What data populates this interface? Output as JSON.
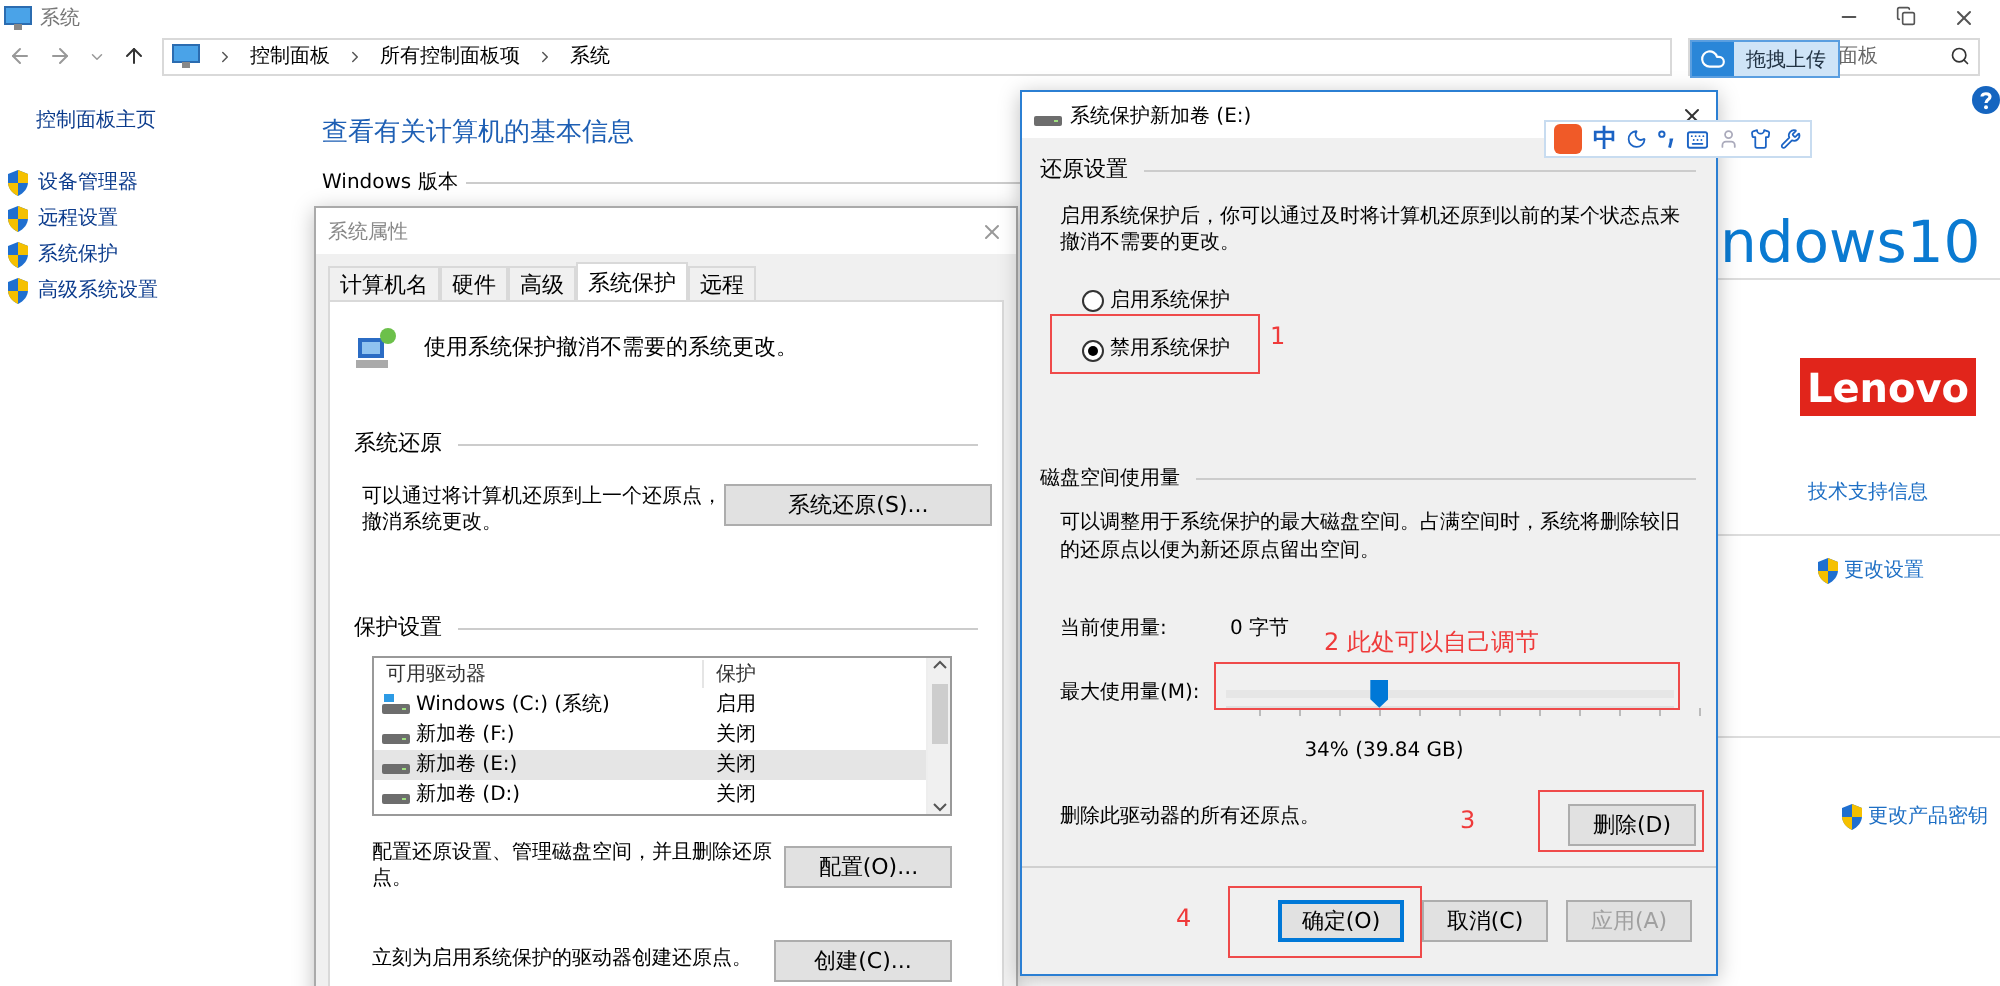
{
  "window": {
    "title": "系统"
  },
  "nav": {
    "breadcrumbs": [
      "控制面板",
      "所有控制面板项",
      "系统"
    ],
    "search_placeholder": "面板"
  },
  "upload_popup": {
    "label": "拖拽上传"
  },
  "sidebar": {
    "home": "控制面板主页",
    "items": [
      "设备管理器",
      "远程设置",
      "系统保护",
      "高级系统设置"
    ]
  },
  "main": {
    "heading": "查看有关计算机的基本信息",
    "section": "Windows 版本",
    "logo_text": "ndows10",
    "brand": "Lenovo",
    "support_link": "技术支持信息",
    "change_settings": "更改设置",
    "change_key": "更改产品密钥"
  },
  "system_properties": {
    "title": "系统属性",
    "tabs": [
      {
        "label": "计算机名",
        "selected": false
      },
      {
        "label": "硬件",
        "selected": false
      },
      {
        "label": "高级",
        "selected": false
      },
      {
        "label": "系统保护",
        "selected": true
      },
      {
        "label": "远程",
        "selected": false
      }
    ],
    "intro": "使用系统保护撤消不需要的系统更改。",
    "restore_section": "系统还原",
    "restore_text": "可以通过将计算机还原到上一个还原点，撤消系统更改。",
    "restore_button": "系统还原(S)...",
    "protection_section": "保护设置",
    "drive_columns": [
      "可用驱动器",
      "保护"
    ],
    "drives": [
      {
        "name": "Windows (C:) (系统)",
        "protection": "启用",
        "kind": "system",
        "selected": false
      },
      {
        "name": "新加卷 (F:)",
        "protection": "关闭",
        "kind": "drive",
        "selected": false
      },
      {
        "name": "新加卷 (E:)",
        "protection": "关闭",
        "kind": "drive",
        "selected": true
      },
      {
        "name": "新加卷 (D:)",
        "protection": "关闭",
        "kind": "drive",
        "selected": false
      }
    ],
    "configure_text": "配置还原设置、管理磁盘空间，并且删除还原点。",
    "configure_button": "配置(O)...",
    "create_text": "立刻为启用系统保护的驱动器创建还原点。",
    "create_button": "创建(C)..."
  },
  "protection_dialog": {
    "title": "系统保护新加卷 (E:)",
    "restore_section": "还原设置",
    "restore_text": "启用系统保护后，你可以通过及时将计算机还原到以前的某个状态点来撤消不需要的更改。",
    "options": [
      {
        "label": "启用系统保护",
        "selected": false
      },
      {
        "label": "禁用系统保护",
        "selected": true
      }
    ],
    "disk_section": "磁盘空间使用量",
    "disk_text": "可以调整用于系统保护的最大磁盘空间。占满空间时，系统将删除较旧的还原点以便为新还原点留出空间。",
    "current_label": "当前使用量:",
    "current_value": "0 字节",
    "max_label": "最大使用量(M):",
    "slider": {
      "level": 0.34
    },
    "usage_reading": "34% (39.84 GB)",
    "delete_text": "删除此驱动器的所有还原点。",
    "delete_button": "删除(D)",
    "buttons": [
      {
        "label": "确定(O)",
        "default": true,
        "disabled": false
      },
      {
        "label": "取消(C)",
        "default": false,
        "disabled": false
      },
      {
        "label": "应用(A)",
        "default": false,
        "disabled": true
      }
    ]
  },
  "ime_toolbar": {
    "mode": "中"
  },
  "annotations": [
    {
      "label": "1"
    },
    {
      "label": "2 此处可以自己调节"
    },
    {
      "label": "3"
    },
    {
      "label": "4"
    }
  ]
}
